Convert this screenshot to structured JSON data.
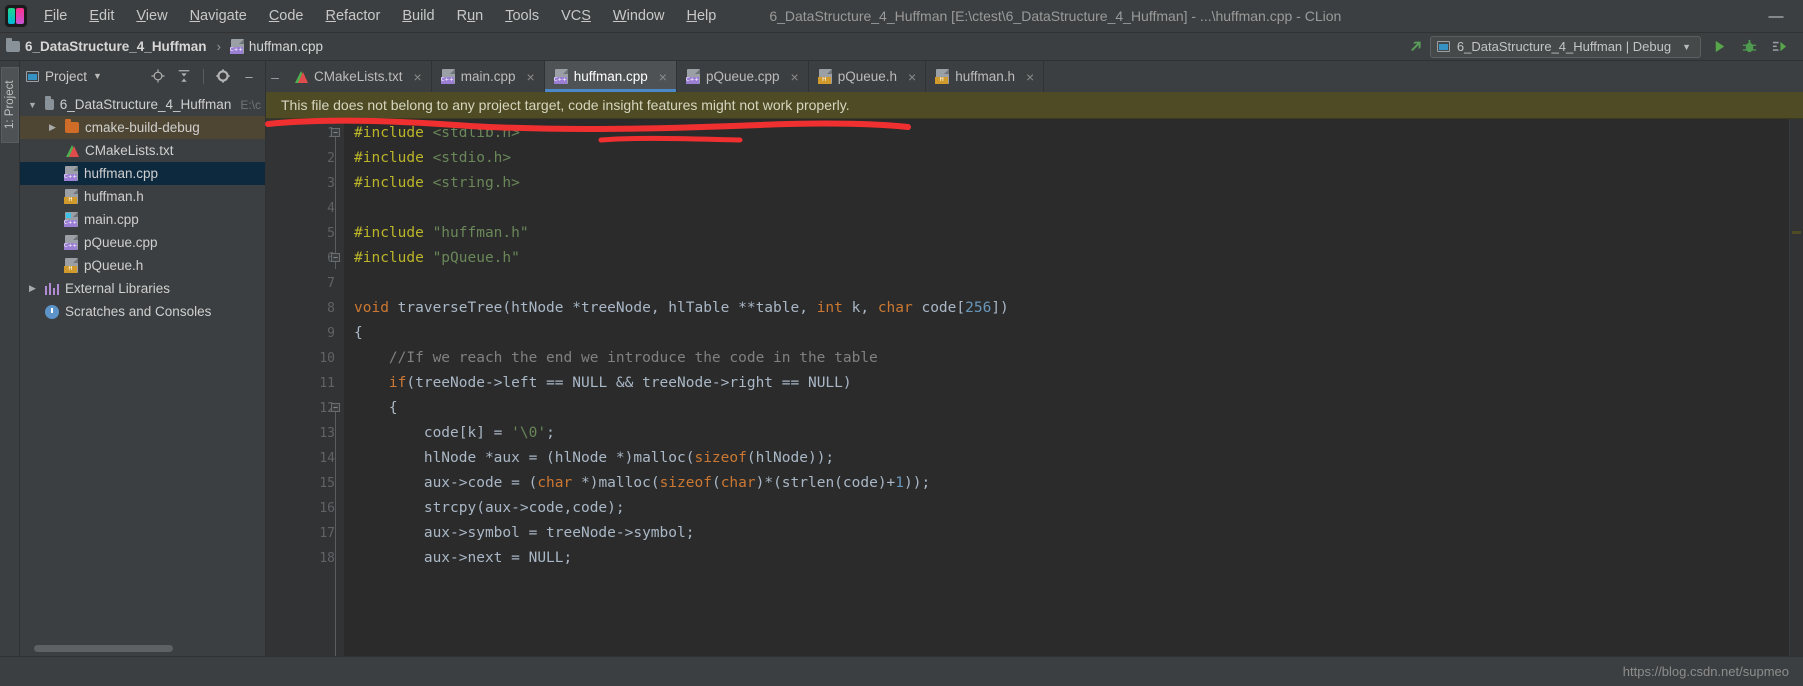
{
  "window": {
    "title": "6_DataStructure_4_Huffman [E:\\ctest\\6_DataStructure_4_Huffman] - ...\\huffman.cpp - CLion",
    "app_icon": "clion-logo-icon",
    "minimize_label": "—"
  },
  "menu": {
    "items": [
      {
        "label": "File"
      },
      {
        "label": "Edit"
      },
      {
        "label": "View"
      },
      {
        "label": "Navigate"
      },
      {
        "label": "Code"
      },
      {
        "label": "Refactor"
      },
      {
        "label": "Build"
      },
      {
        "label": "Run"
      },
      {
        "label": "Tools"
      },
      {
        "label": "VCS"
      },
      {
        "label": "Window"
      },
      {
        "label": "Help"
      }
    ]
  },
  "navbar": {
    "project_name": "6_DataStructure_4_Huffman",
    "separator": "›",
    "file_name": "huffman.cpp",
    "run_config": "6_DataStructure_4_Huffman | Debug",
    "caret": "▼",
    "icons": [
      "update-project-icon",
      "run-icon",
      "debug-icon",
      "run-with-coverage-icon"
    ]
  },
  "rail": {
    "project_tab": "1: Project"
  },
  "panel": {
    "title": "Project",
    "caret": "▼",
    "icons": [
      "locate-icon",
      "collapse-all-icon",
      "settings-gear-icon",
      "hide-icon"
    ],
    "tree": [
      {
        "label": "6_DataStructure_4_Huffman",
        "suffix": "E:\\c",
        "icon": "folder-icon",
        "arrow": "▼",
        "indent": 0,
        "state": "normal"
      },
      {
        "label": "cmake-build-debug",
        "suffix": "",
        "icon": "folder-orange-icon",
        "arrow": "▶",
        "indent": 1,
        "state": "highlight"
      },
      {
        "label": "CMakeLists.txt",
        "suffix": "",
        "icon": "cmake-icon",
        "arrow": "",
        "indent": 1,
        "state": "normal"
      },
      {
        "label": "huffman.cpp",
        "suffix": "",
        "icon": "cpp-file-icon",
        "arrow": "",
        "indent": 1,
        "state": "selected"
      },
      {
        "label": "huffman.h",
        "suffix": "",
        "icon": "h-file-icon",
        "arrow": "",
        "indent": 1,
        "state": "normal"
      },
      {
        "label": "main.cpp",
        "suffix": "",
        "icon": "cpp-main-file-icon",
        "arrow": "",
        "indent": 1,
        "state": "normal"
      },
      {
        "label": "pQueue.cpp",
        "suffix": "",
        "icon": "cpp-file-icon",
        "arrow": "",
        "indent": 1,
        "state": "normal"
      },
      {
        "label": "pQueue.h",
        "suffix": "",
        "icon": "h-file-icon",
        "arrow": "",
        "indent": 1,
        "state": "normal"
      },
      {
        "label": "External Libraries",
        "suffix": "",
        "icon": "libraries-icon",
        "arrow": "▶",
        "indent": 0,
        "state": "normal"
      },
      {
        "label": "Scratches and Consoles",
        "suffix": "",
        "icon": "scratches-icon",
        "arrow": "",
        "indent": 0,
        "state": "normal"
      }
    ]
  },
  "editor": {
    "tabs": [
      {
        "label": "CMakeLists.txt",
        "icon": "cmake-icon",
        "active": false,
        "close": "×"
      },
      {
        "label": "main.cpp",
        "icon": "cpp-file-icon",
        "active": false,
        "close": "×"
      },
      {
        "label": "huffman.cpp",
        "icon": "cpp-file-icon",
        "active": true,
        "close": "×"
      },
      {
        "label": "pQueue.cpp",
        "icon": "cpp-file-icon",
        "active": false,
        "close": "×"
      },
      {
        "label": "pQueue.h",
        "icon": "h-file-icon",
        "active": false,
        "close": "×"
      },
      {
        "label": "huffman.h",
        "icon": "h-file-icon",
        "active": false,
        "close": "×"
      }
    ],
    "notice": "This file does not belong to any project target, code insight features might not work properly.",
    "line_numbers": [
      "1",
      "2",
      "3",
      "4",
      "5",
      "6",
      "7",
      "8",
      "9",
      "10",
      "11",
      "12",
      "13",
      "14",
      "15",
      "16",
      "17",
      "18"
    ],
    "lines": [
      [
        {
          "t": "#include ",
          "c": "pp"
        },
        {
          "t": "<stdlib.h>",
          "c": "s"
        }
      ],
      [
        {
          "t": "#include ",
          "c": "pp"
        },
        {
          "t": "<stdio.h>",
          "c": "s"
        }
      ],
      [
        {
          "t": "#include ",
          "c": "pp"
        },
        {
          "t": "<string.h>",
          "c": "s"
        }
      ],
      [],
      [
        {
          "t": "#include ",
          "c": "pp"
        },
        {
          "t": "\"huffman.h\"",
          "c": "s"
        }
      ],
      [
        {
          "t": "#include ",
          "c": "pp"
        },
        {
          "t": "\"pQueue.h\"",
          "c": "s"
        }
      ],
      [],
      [
        {
          "t": "void ",
          "c": "k"
        },
        {
          "t": "traverseTree(htNode *treeNode, hlTable **table, ",
          "c": "t"
        },
        {
          "t": "int",
          "c": "k"
        },
        {
          "t": " k, ",
          "c": "t"
        },
        {
          "t": "char",
          "c": "k"
        },
        {
          "t": " code[",
          "c": "t"
        },
        {
          "t": "256",
          "c": "n"
        },
        {
          "t": "])",
          "c": "t"
        }
      ],
      [
        {
          "t": "{",
          "c": "t"
        }
      ],
      [
        {
          "t": "    //If we reach the end we introduce the code in the table",
          "c": "c"
        }
      ],
      [
        {
          "t": "    ",
          "c": "t"
        },
        {
          "t": "if",
          "c": "k"
        },
        {
          "t": "(treeNode->left == NULL && treeNode->right == NULL)",
          "c": "t"
        }
      ],
      [
        {
          "t": "    {",
          "c": "t"
        }
      ],
      [
        {
          "t": "        code[k] = ",
          "c": "t"
        },
        {
          "t": "'\\0'",
          "c": "s"
        },
        {
          "t": ";",
          "c": "t"
        }
      ],
      [
        {
          "t": "        hlNode *aux = (hlNode *)malloc(",
          "c": "t"
        },
        {
          "t": "sizeof",
          "c": "k"
        },
        {
          "t": "(hlNode));",
          "c": "t"
        }
      ],
      [
        {
          "t": "        aux->code = (",
          "c": "t"
        },
        {
          "t": "char",
          "c": "k"
        },
        {
          "t": " *)malloc(",
          "c": "t"
        },
        {
          "t": "sizeof",
          "c": "k"
        },
        {
          "t": "(",
          "c": "t"
        },
        {
          "t": "char",
          "c": "k"
        },
        {
          "t": ")*(strlen(code)+",
          "c": "t"
        },
        {
          "t": "1",
          "c": "n"
        },
        {
          "t": "));",
          "c": "t"
        }
      ],
      [
        {
          "t": "        strcpy(aux->code,code);",
          "c": "t"
        }
      ],
      [
        {
          "t": "        aux->symbol = treeNode->symbol;",
          "c": "t"
        }
      ],
      [
        {
          "t": "        aux->next = NULL;",
          "c": "t"
        }
      ]
    ]
  },
  "statusbar": {
    "url": "https://blog.csdn.net/supmeo"
  },
  "colors": {
    "accent_blue": "#4a88c7",
    "selection_blue": "#0d293e",
    "notice_olive": "#4f4b24",
    "annotation_red": "#f03030",
    "keyword_orange": "#cc7832",
    "string_green": "#6a8759",
    "preproc_yellow": "#bbb529",
    "number_blue": "#6897bb",
    "comment_gray": "#808080",
    "editor_bg": "#2b2b2b",
    "chrome_bg": "#3c3f41"
  }
}
